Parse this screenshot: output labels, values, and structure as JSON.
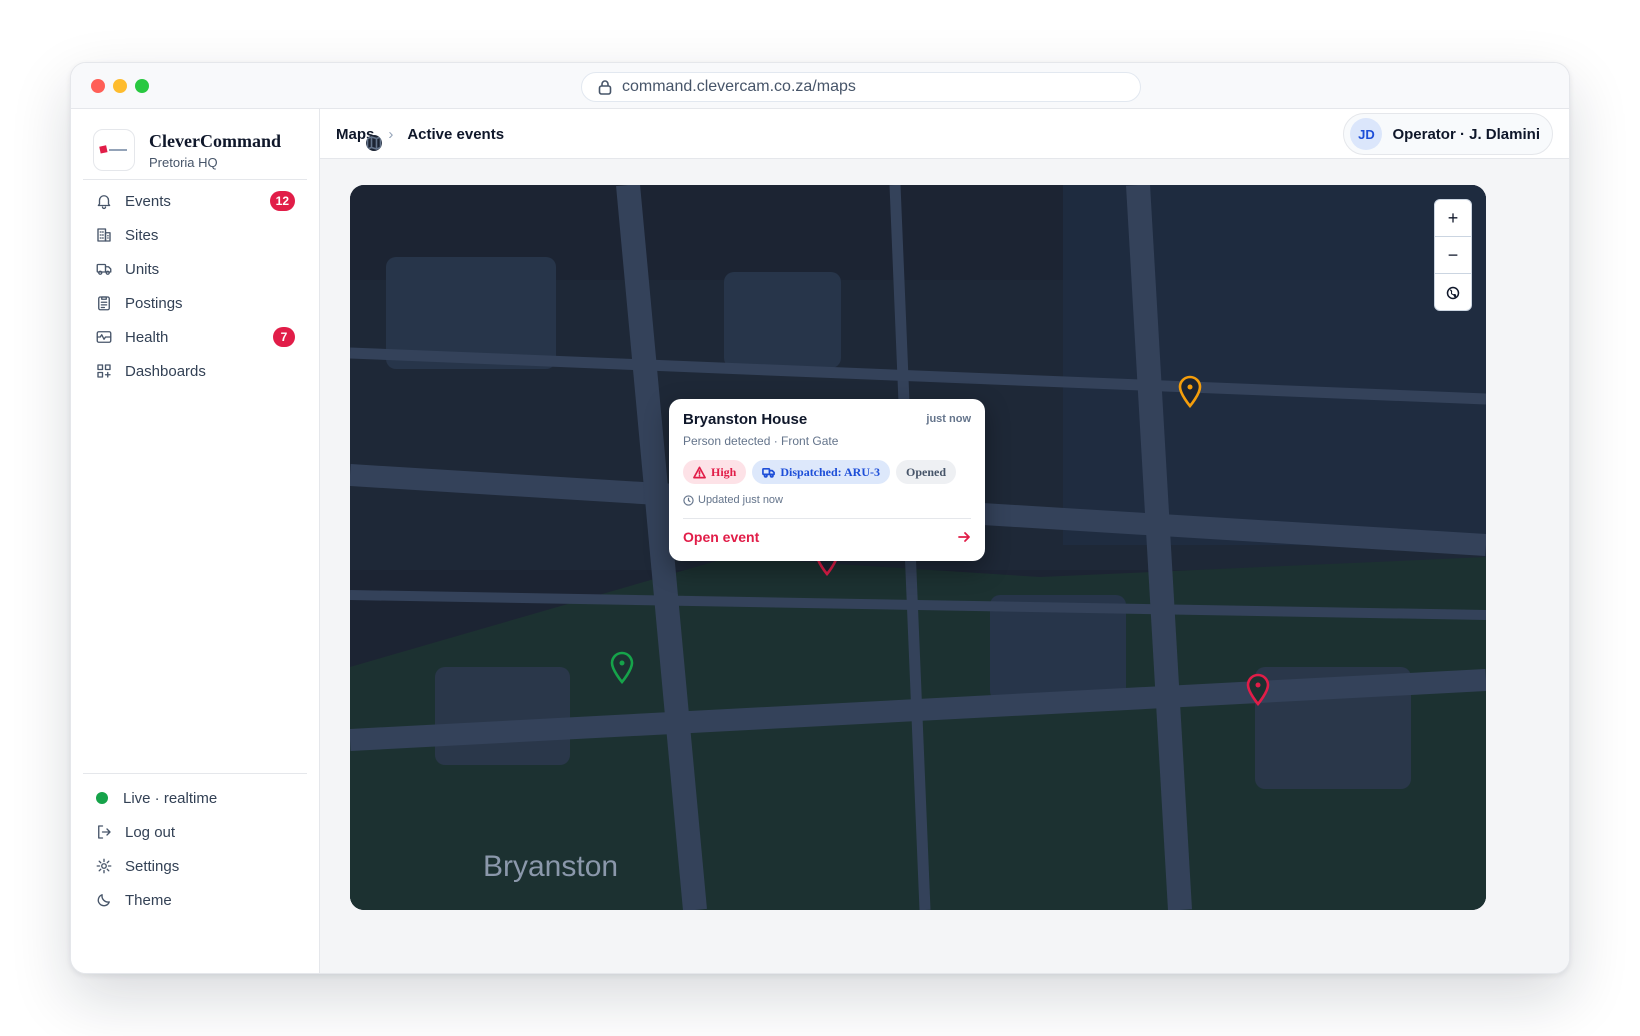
{
  "browser": {
    "url": "command.clevercam.co.za/maps"
  },
  "brand": {
    "name": "CleverCommand",
    "location": "Pretoria HQ"
  },
  "nav": {
    "items": [
      {
        "label": "Events",
        "icon": "bell-icon",
        "badge": "12"
      },
      {
        "label": "Sites",
        "icon": "building-icon"
      },
      {
        "label": "Units",
        "icon": "truck-icon"
      },
      {
        "label": "Postings",
        "icon": "clipboard-icon"
      },
      {
        "label": "Health",
        "icon": "pulse-icon",
        "badge": "7"
      },
      {
        "label": "Dashboards",
        "icon": "grid-plus-icon"
      }
    ],
    "footer": {
      "status": "Live · realtime",
      "logout": "Log out",
      "settings": "Settings",
      "theme": "Theme"
    }
  },
  "breadcrumb": {
    "root": "Maps",
    "current": "Active events"
  },
  "operator": {
    "initials": "JD",
    "label": "Operator · J. Dlamini"
  },
  "map": {
    "area_label": "Bryanston",
    "zoom_in": "+",
    "zoom_out": "−",
    "markers": [
      {
        "color": "#f59e0b",
        "kind": "warning"
      },
      {
        "color": "#16a34a",
        "kind": "ok"
      },
      {
        "color": "#e11d48",
        "kind": "alert"
      },
      {
        "color": "#e11d48",
        "kind": "alert-selected"
      }
    ]
  },
  "popup": {
    "title": "Bryanston House",
    "time": "just now",
    "subtitle": "Person detected · Front Gate",
    "chips": {
      "severity": "High",
      "dispatch": "Dispatched: ARU-3",
      "status": "Opened"
    },
    "updated": "Updated just now",
    "action": "Open event"
  },
  "colors": {
    "accent": "#e11d48",
    "info": "#1d4ed8",
    "ok": "#16a34a",
    "warn": "#f59e0b"
  }
}
